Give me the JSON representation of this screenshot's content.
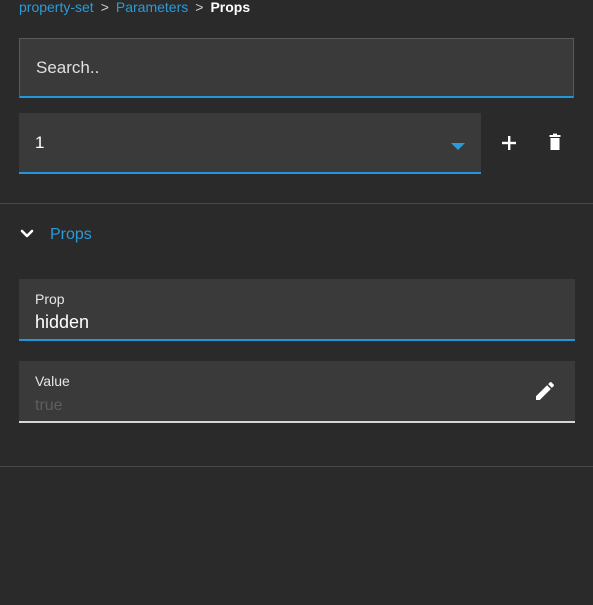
{
  "breadcrumb": {
    "items": [
      "property-set",
      "Parameters"
    ],
    "separator": ">",
    "current": "Props"
  },
  "search": {
    "placeholder": "Search.."
  },
  "selector": {
    "value": "1"
  },
  "section": {
    "title": "Props",
    "expanded": true
  },
  "fields": {
    "prop": {
      "label": "Prop",
      "value": "hidden"
    },
    "value": {
      "label": "Value",
      "placeholder": "true"
    }
  },
  "icons": {
    "caret": "caret-down-icon",
    "add": "plus-icon",
    "delete": "trash-icon",
    "chevron": "chevron-down-icon",
    "edit": "pencil-icon"
  },
  "colors": {
    "background": "#2a2a2a",
    "field": "#3a3a3a",
    "accent": "#2a9bd8",
    "underline_active": "#2196d9",
    "underline_inactive": "#d6d6d6"
  }
}
